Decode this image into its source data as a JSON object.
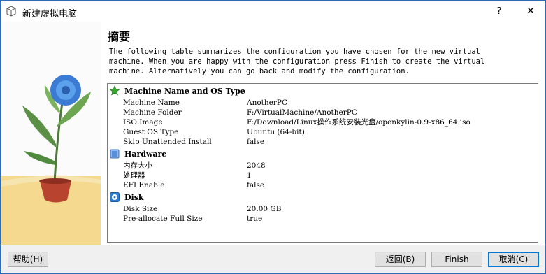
{
  "window": {
    "title": "新建虚拟电脑",
    "help_label": "?",
    "close_label": "✕"
  },
  "page": {
    "heading": "摘要",
    "description": "The following table summarizes the configuration you have chosen for the new virtual\nmachine. When you are happy with the configuration press Finish to create the virtual\nmachine. Alternatively you can go back and modify the configuration."
  },
  "summary": {
    "machine": {
      "title": "Machine Name and OS Type",
      "rows": [
        {
          "key": "Machine Name",
          "value": "AnotherPC"
        },
        {
          "key": "Machine Folder",
          "value": "F:/VirtualMachine/AnotherPC"
        },
        {
          "key": "ISO Image",
          "value": "F:/Download/Linux操作系统安装光盘/openkylin-0.9-x86_64.iso"
        },
        {
          "key": "Guest OS Type",
          "value": "Ubuntu (64-bit)"
        },
        {
          "key": "Skip Unattended Install",
          "value": "false"
        }
      ]
    },
    "hardware": {
      "title": "Hardware",
      "rows": [
        {
          "key": "内存大小",
          "value": "2048"
        },
        {
          "key": "处理器",
          "value": "1"
        },
        {
          "key": "EFI Enable",
          "value": "false"
        }
      ]
    },
    "disk": {
      "title": "Disk",
      "rows": [
        {
          "key": "Disk Size",
          "value": "20.00 GB"
        },
        {
          "key": "Pre-allocate Full Size",
          "value": "true"
        }
      ]
    }
  },
  "buttons": {
    "help": "帮助(H)",
    "back": "返回(B)",
    "finish": "Finish",
    "cancel": "取消(C)"
  },
  "colors": {
    "accent": "#0078d7",
    "window_border": "#2b6cb5",
    "machine_icon": "#3aa832",
    "hardware_icon": "#5a8fd8",
    "disk_icon": "#2a7fd4"
  }
}
